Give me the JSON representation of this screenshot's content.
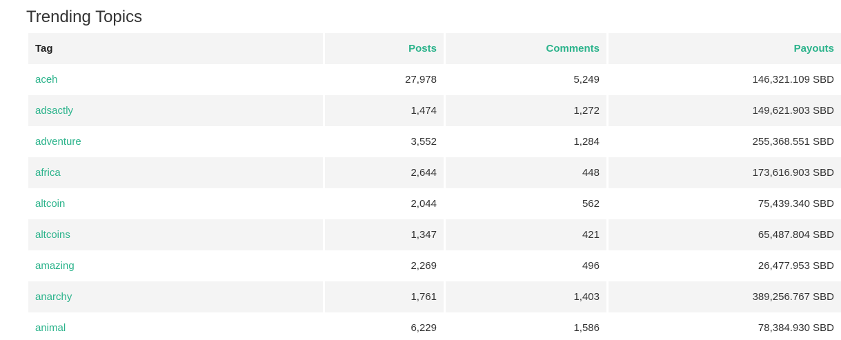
{
  "page": {
    "title": "Trending Topics"
  },
  "table": {
    "headers": {
      "tag": "Tag",
      "posts": "Posts",
      "comments": "Comments",
      "payouts": "Payouts"
    },
    "rows": [
      {
        "tag": "aceh",
        "posts": "27,978",
        "comments": "5,249",
        "payouts": "146,321.109 SBD"
      },
      {
        "tag": "adsactly",
        "posts": "1,474",
        "comments": "1,272",
        "payouts": "149,621.903 SBD"
      },
      {
        "tag": "adventure",
        "posts": "3,552",
        "comments": "1,284",
        "payouts": "255,368.551 SBD"
      },
      {
        "tag": "africa",
        "posts": "2,644",
        "comments": "448",
        "payouts": "173,616.903 SBD"
      },
      {
        "tag": "altcoin",
        "posts": "2,044",
        "comments": "562",
        "payouts": "75,439.340 SBD"
      },
      {
        "tag": "altcoins",
        "posts": "1,347",
        "comments": "421",
        "payouts": "65,487.804 SBD"
      },
      {
        "tag": "amazing",
        "posts": "2,269",
        "comments": "496",
        "payouts": "26,477.953 SBD"
      },
      {
        "tag": "anarchy",
        "posts": "1,761",
        "comments": "1,403",
        "payouts": "389,256.767 SBD"
      },
      {
        "tag": "animal",
        "posts": "6,229",
        "comments": "1,586",
        "payouts": "78,384.930 SBD"
      }
    ]
  },
  "colors": {
    "accent": "#2bb38b",
    "header_bg": "#f4f4f4",
    "stripe_bg": "#f4f4f4",
    "text": "#333333"
  }
}
